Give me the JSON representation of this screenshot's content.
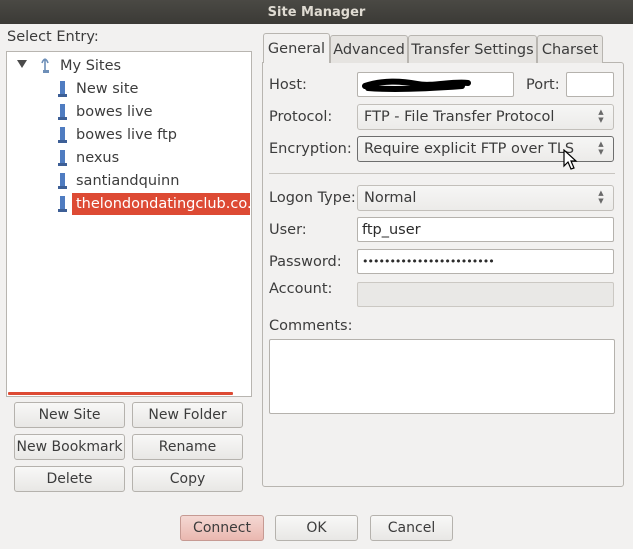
{
  "window": {
    "title": "Site Manager"
  },
  "tree": {
    "label": "Select Entry:",
    "root": "My Sites",
    "items": [
      "New site",
      "bowes live",
      "bowes live ftp",
      "nexus",
      "santiandquinn",
      "thelondondatingclub.co.uk"
    ],
    "selected_index": 5
  },
  "left_buttons": {
    "new_site": "New Site",
    "new_folder": "New Folder",
    "new_bookmark": "New Bookmark",
    "rename": "Rename",
    "delete": "Delete",
    "copy": "Copy"
  },
  "tabs": [
    "General",
    "Advanced",
    "Transfer Settings",
    "Charset"
  ],
  "general": {
    "host_label": "Host:",
    "port_label": "Port:",
    "port_value": "",
    "protocol_label": "Protocol:",
    "protocol_value": "FTP - File Transfer Protocol",
    "encryption_label": "Encryption:",
    "encryption_value": "Require explicit FTP over TLS",
    "logon_type_label": "Logon Type:",
    "logon_type_value": "Normal",
    "user_label": "User:",
    "user_value": "ftp_user",
    "password_label": "Password:",
    "password_value": "••••••••••••••••••••••••",
    "account_label": "Account:",
    "comments_label": "Comments:"
  },
  "footer": {
    "connect": "Connect",
    "ok": "OK",
    "cancel": "Cancel"
  },
  "colors": {
    "accent": "#dd4a34",
    "titlebar": "#3c3b37"
  }
}
